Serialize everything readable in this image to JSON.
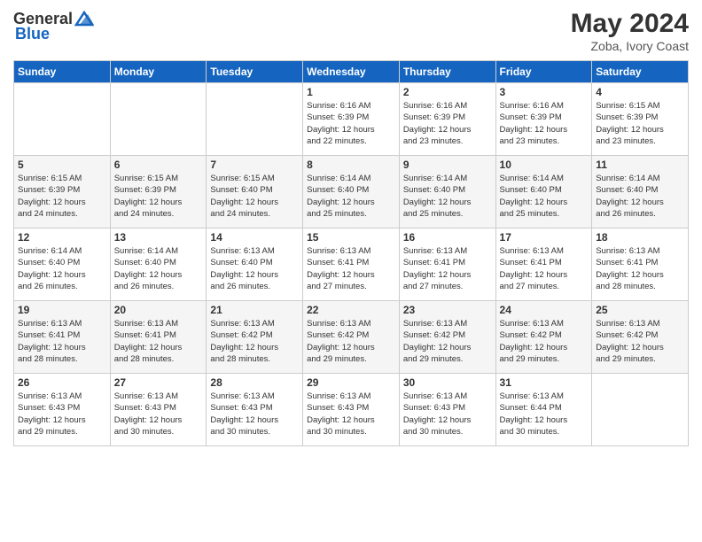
{
  "header": {
    "logo_general": "General",
    "logo_blue": "Blue",
    "month_year": "May 2024",
    "location": "Zoba, Ivory Coast"
  },
  "days_of_week": [
    "Sunday",
    "Monday",
    "Tuesday",
    "Wednesday",
    "Thursday",
    "Friday",
    "Saturday"
  ],
  "weeks": [
    [
      {
        "day": "",
        "info": ""
      },
      {
        "day": "",
        "info": ""
      },
      {
        "day": "",
        "info": ""
      },
      {
        "day": "1",
        "info": "Sunrise: 6:16 AM\nSunset: 6:39 PM\nDaylight: 12 hours\nand 22 minutes."
      },
      {
        "day": "2",
        "info": "Sunrise: 6:16 AM\nSunset: 6:39 PM\nDaylight: 12 hours\nand 23 minutes."
      },
      {
        "day": "3",
        "info": "Sunrise: 6:16 AM\nSunset: 6:39 PM\nDaylight: 12 hours\nand 23 minutes."
      },
      {
        "day": "4",
        "info": "Sunrise: 6:15 AM\nSunset: 6:39 PM\nDaylight: 12 hours\nand 23 minutes."
      }
    ],
    [
      {
        "day": "5",
        "info": "Sunrise: 6:15 AM\nSunset: 6:39 PM\nDaylight: 12 hours\nand 24 minutes."
      },
      {
        "day": "6",
        "info": "Sunrise: 6:15 AM\nSunset: 6:39 PM\nDaylight: 12 hours\nand 24 minutes."
      },
      {
        "day": "7",
        "info": "Sunrise: 6:15 AM\nSunset: 6:40 PM\nDaylight: 12 hours\nand 24 minutes."
      },
      {
        "day": "8",
        "info": "Sunrise: 6:14 AM\nSunset: 6:40 PM\nDaylight: 12 hours\nand 25 minutes."
      },
      {
        "day": "9",
        "info": "Sunrise: 6:14 AM\nSunset: 6:40 PM\nDaylight: 12 hours\nand 25 minutes."
      },
      {
        "day": "10",
        "info": "Sunrise: 6:14 AM\nSunset: 6:40 PM\nDaylight: 12 hours\nand 25 minutes."
      },
      {
        "day": "11",
        "info": "Sunrise: 6:14 AM\nSunset: 6:40 PM\nDaylight: 12 hours\nand 26 minutes."
      }
    ],
    [
      {
        "day": "12",
        "info": "Sunrise: 6:14 AM\nSunset: 6:40 PM\nDaylight: 12 hours\nand 26 minutes."
      },
      {
        "day": "13",
        "info": "Sunrise: 6:14 AM\nSunset: 6:40 PM\nDaylight: 12 hours\nand 26 minutes."
      },
      {
        "day": "14",
        "info": "Sunrise: 6:13 AM\nSunset: 6:40 PM\nDaylight: 12 hours\nand 26 minutes."
      },
      {
        "day": "15",
        "info": "Sunrise: 6:13 AM\nSunset: 6:41 PM\nDaylight: 12 hours\nand 27 minutes."
      },
      {
        "day": "16",
        "info": "Sunrise: 6:13 AM\nSunset: 6:41 PM\nDaylight: 12 hours\nand 27 minutes."
      },
      {
        "day": "17",
        "info": "Sunrise: 6:13 AM\nSunset: 6:41 PM\nDaylight: 12 hours\nand 27 minutes."
      },
      {
        "day": "18",
        "info": "Sunrise: 6:13 AM\nSunset: 6:41 PM\nDaylight: 12 hours\nand 28 minutes."
      }
    ],
    [
      {
        "day": "19",
        "info": "Sunrise: 6:13 AM\nSunset: 6:41 PM\nDaylight: 12 hours\nand 28 minutes."
      },
      {
        "day": "20",
        "info": "Sunrise: 6:13 AM\nSunset: 6:41 PM\nDaylight: 12 hours\nand 28 minutes."
      },
      {
        "day": "21",
        "info": "Sunrise: 6:13 AM\nSunset: 6:42 PM\nDaylight: 12 hours\nand 28 minutes."
      },
      {
        "day": "22",
        "info": "Sunrise: 6:13 AM\nSunset: 6:42 PM\nDaylight: 12 hours\nand 29 minutes."
      },
      {
        "day": "23",
        "info": "Sunrise: 6:13 AM\nSunset: 6:42 PM\nDaylight: 12 hours\nand 29 minutes."
      },
      {
        "day": "24",
        "info": "Sunrise: 6:13 AM\nSunset: 6:42 PM\nDaylight: 12 hours\nand 29 minutes."
      },
      {
        "day": "25",
        "info": "Sunrise: 6:13 AM\nSunset: 6:42 PM\nDaylight: 12 hours\nand 29 minutes."
      }
    ],
    [
      {
        "day": "26",
        "info": "Sunrise: 6:13 AM\nSunset: 6:43 PM\nDaylight: 12 hours\nand 29 minutes."
      },
      {
        "day": "27",
        "info": "Sunrise: 6:13 AM\nSunset: 6:43 PM\nDaylight: 12 hours\nand 30 minutes."
      },
      {
        "day": "28",
        "info": "Sunrise: 6:13 AM\nSunset: 6:43 PM\nDaylight: 12 hours\nand 30 minutes."
      },
      {
        "day": "29",
        "info": "Sunrise: 6:13 AM\nSunset: 6:43 PM\nDaylight: 12 hours\nand 30 minutes."
      },
      {
        "day": "30",
        "info": "Sunrise: 6:13 AM\nSunset: 6:43 PM\nDaylight: 12 hours\nand 30 minutes."
      },
      {
        "day": "31",
        "info": "Sunrise: 6:13 AM\nSunset: 6:44 PM\nDaylight: 12 hours\nand 30 minutes."
      },
      {
        "day": "",
        "info": ""
      }
    ]
  ]
}
